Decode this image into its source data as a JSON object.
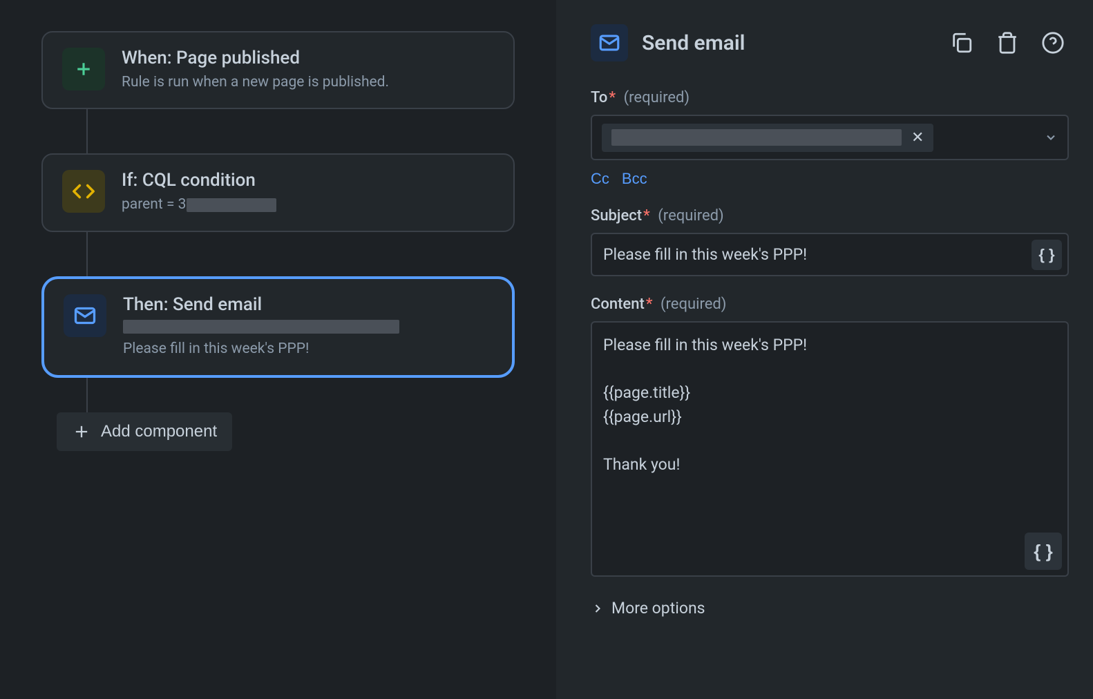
{
  "rules": {
    "trigger": {
      "title": "When: Page published",
      "subtitle": "Rule is run when a new page is published."
    },
    "condition": {
      "title": "If: CQL condition",
      "subtitle_prefix": "parent = 3"
    },
    "action": {
      "title": "Then: Send email",
      "subtitle_line2": "Please fill in this week's PPP!"
    },
    "add_component_label": "Add component"
  },
  "panel": {
    "title": "Send email",
    "fields": {
      "to": {
        "label": "To",
        "required_text": "(required)"
      },
      "cc_label": "Cc",
      "bcc_label": "Bcc",
      "subject": {
        "label": "Subject",
        "required_text": "(required)",
        "value": "Please fill in this week's PPP!"
      },
      "content": {
        "label": "Content",
        "required_text": "(required)",
        "value": "Please fill in this week's PPP!\n\n{{page.title}}\n{{page.url}}\n\nThank you!"
      }
    },
    "more_options_label": "More options"
  }
}
